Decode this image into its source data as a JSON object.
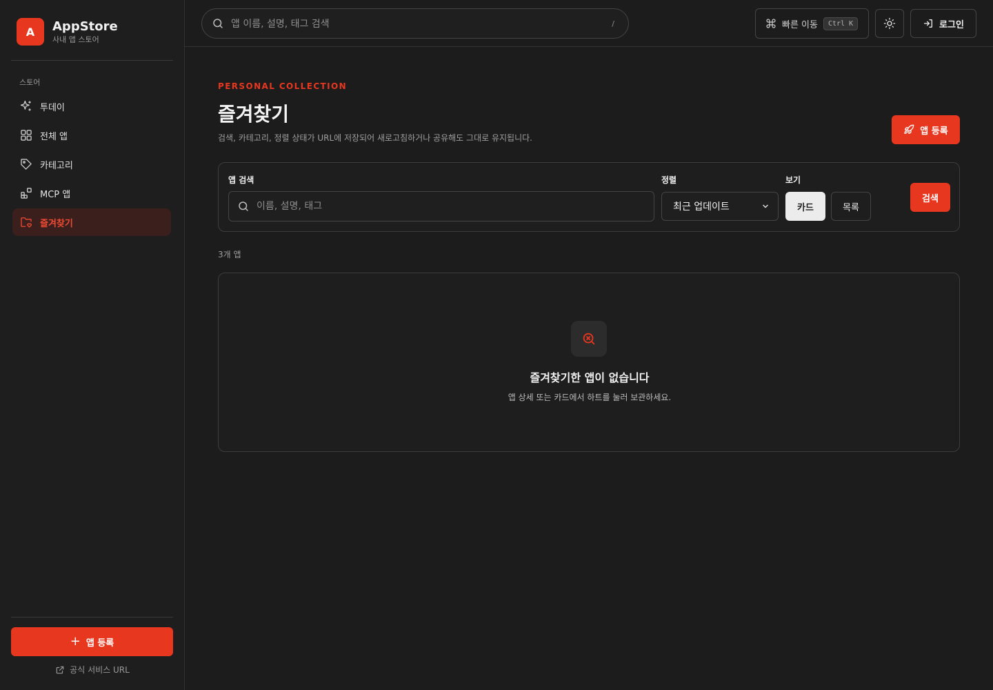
{
  "brand": {
    "logo_letter": "A",
    "title": "AppStore",
    "subtitle": "사내 앱 스토어"
  },
  "sidebar": {
    "section_label": "스토어",
    "items": [
      {
        "label": "투데이",
        "icon": "sparkles-icon",
        "active": false
      },
      {
        "label": "전체 앱",
        "icon": "grid-icon",
        "active": false
      },
      {
        "label": "카테고리",
        "icon": "tag-icon",
        "active": false
      },
      {
        "label": "MCP 앱",
        "icon": "blocks-icon",
        "active": false
      },
      {
        "label": "즐겨찾기",
        "icon": "folder-heart-icon",
        "active": true
      }
    ],
    "cta_plus": "+",
    "cta_label": "앱 등록",
    "footer_link": "공식 서비스 URL"
  },
  "topbar": {
    "search_placeholder": "앱 이름, 설명, 태그 검색",
    "search_shortcut": "/",
    "quick_label": "빠른 이동",
    "quick_shortcut": "Ctrl K",
    "login_label": "로그인"
  },
  "main": {
    "eyebrow": "PERSONAL COLLECTION",
    "title": "즐겨찾기",
    "description": "검색, 카테고리, 정렬 상태가 URL에 저장되어 새로고침하거나 공유해도 그대로 유지됩니다.",
    "register_label": "앱 등록",
    "filters": {
      "search_label": "앱 검색",
      "search_placeholder": "이름, 설명, 태그",
      "search_value": "",
      "sort_label": "정렬",
      "sort_selected": "최근 업데이트",
      "view_label": "보기",
      "view_card": "카드",
      "view_list": "목록",
      "submit_label": "검색"
    },
    "count_text": "3개 앱",
    "empty": {
      "title": "즐겨찾기한 앱이 없습니다",
      "description": "앱 상세 또는 카드에서 하트를 눌러 보관하세요."
    }
  },
  "colors": {
    "accent": "#e8371f",
    "background": "#1c1c1c",
    "border": "#3d3d3d"
  }
}
